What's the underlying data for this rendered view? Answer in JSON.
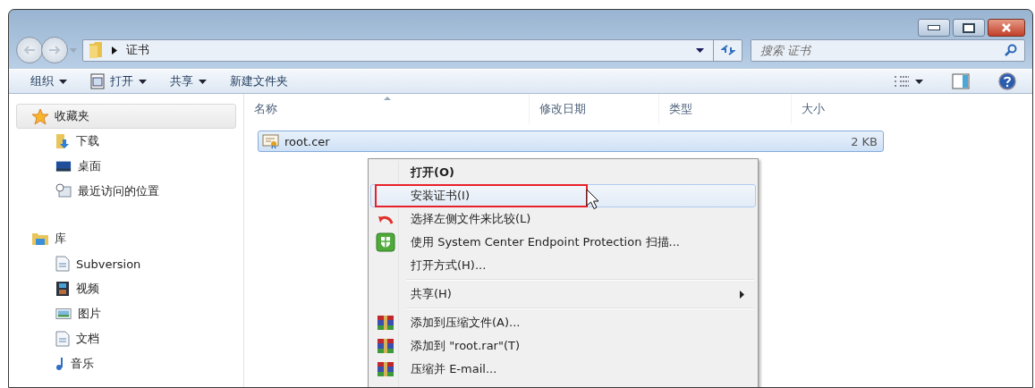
{
  "address_bar": {
    "path": [
      "证书"
    ]
  },
  "search": {
    "placeholder": "搜索 证书"
  },
  "toolbar": {
    "buttons": [
      {
        "label": "组织",
        "kind": "dropdown"
      },
      {
        "label": "打开",
        "kind": "open"
      },
      {
        "label": "共享",
        "kind": "dropdown"
      },
      {
        "label": "新建文件夹",
        "kind": "plain"
      }
    ]
  },
  "sidebar": {
    "groups": [
      {
        "label": "收藏夹",
        "kind": "favorites",
        "selected": true,
        "children": [
          {
            "label": "下载",
            "kind": "download"
          },
          {
            "label": "桌面",
            "kind": "desktop"
          },
          {
            "label": "最近访问的位置",
            "kind": "recent"
          }
        ]
      },
      {
        "label": "库",
        "kind": "library",
        "selected": false,
        "children": [
          {
            "label": "Subversion",
            "kind": "doc"
          },
          {
            "label": "视频",
            "kind": "video"
          },
          {
            "label": "图片",
            "kind": "picture"
          },
          {
            "label": "文档",
            "kind": "doc"
          },
          {
            "label": "音乐",
            "kind": "music"
          }
        ]
      }
    ]
  },
  "table": {
    "columns": [
      "名称",
      "修改日期",
      "类型",
      "大小"
    ],
    "rows": [
      {
        "name": "root.cer",
        "size": "2 KB",
        "selected": true
      }
    ]
  },
  "context_menu": {
    "items": [
      {
        "kind": "item",
        "label": "打开(O)",
        "default": true,
        "selected": false,
        "marked": false
      },
      {
        "kind": "item",
        "label": "安装证书(I)",
        "default": false,
        "selected": true,
        "marked": true
      },
      {
        "kind": "revert",
        "label": "选择左侧文件来比较(L)",
        "default": false,
        "selected": false,
        "marked": false
      },
      {
        "kind": "shield",
        "label": "使用 System Center Endpoint Protection 扫描...",
        "default": false,
        "selected": false,
        "marked": false
      },
      {
        "kind": "item",
        "label": "打开方式(H)...",
        "default": false,
        "selected": false,
        "marked": false
      },
      {
        "kind": "separator"
      },
      {
        "kind": "submenu",
        "label": "共享(H)",
        "default": false,
        "selected": false,
        "marked": false
      },
      {
        "kind": "separator"
      },
      {
        "kind": "archive",
        "label": "添加到压缩文件(A)...",
        "default": false,
        "selected": false,
        "marked": false
      },
      {
        "kind": "archive",
        "label": "添加到 \"root.rar\"(T)",
        "default": false,
        "selected": false,
        "marked": false
      },
      {
        "kind": "archive",
        "label": "压缩并 E-mail...",
        "default": false,
        "selected": false,
        "marked": false
      }
    ]
  }
}
